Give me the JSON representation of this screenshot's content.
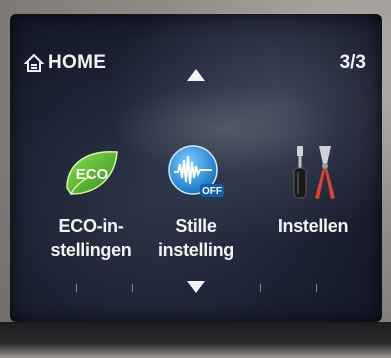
{
  "header": {
    "home_label": "HOME",
    "home_icon": "home-icon",
    "page_indicator": "3/3"
  },
  "navigation": {
    "up_icon": "arrow-up-icon",
    "down_icon": "arrow-down-icon"
  },
  "menu_items": [
    {
      "label_line1": "ECO-in-",
      "label_line2": "stellingen",
      "icon": "eco-leaf-icon",
      "icon_text": "ECO"
    },
    {
      "label_line1": "Stille",
      "label_line2": "instelling",
      "icon": "quiet-mode-icon",
      "icon_text": "OFF"
    },
    {
      "label_line1": "Instellen",
      "label_line2": "",
      "icon": "tools-icon"
    }
  ],
  "colors": {
    "screen_background": "#1a2030",
    "text": "#f3f3f3",
    "eco_green": "#4caf2f",
    "quiet_blue": "#1e8fe0"
  }
}
